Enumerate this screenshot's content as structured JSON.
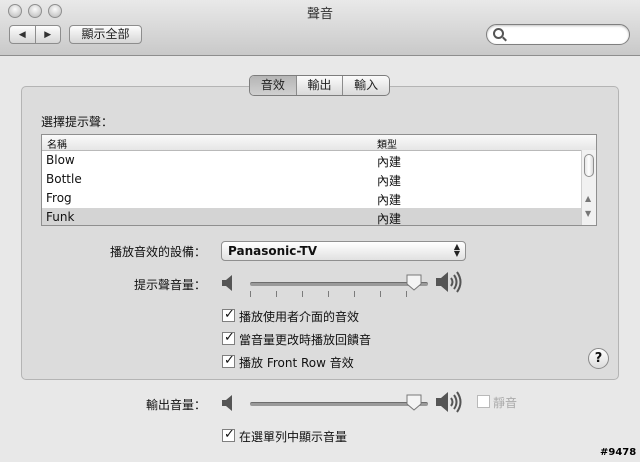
{
  "window": {
    "title": "聲音"
  },
  "toolbar": {
    "back_icon": "◀",
    "forward_icon": "▶",
    "show_all": "顯示全部",
    "search_placeholder": ""
  },
  "tabs": [
    {
      "label": "音效"
    },
    {
      "label": "輸出"
    },
    {
      "label": "輸入"
    }
  ],
  "sound_effects": {
    "choose_label": "選擇提示聲：",
    "columns": {
      "name": "名稱",
      "type": "類型"
    },
    "rows": [
      {
        "name": "Blow",
        "type": "內建"
      },
      {
        "name": "Bottle",
        "type": "內建"
      },
      {
        "name": "Frog",
        "type": "內建"
      },
      {
        "name": "Funk",
        "type": "內建"
      }
    ],
    "selected": "Funk",
    "device_label": "播放音效的設備：",
    "device_value": "Panasonic-TV",
    "alert_volume_label": "提示聲音量：",
    "alert_volume_level": 0.92,
    "options": [
      {
        "label": "播放使用者介面的音效",
        "checked": true
      },
      {
        "label": "當音量更改時播放回饋音",
        "checked": true
      },
      {
        "label": "播放 Front Row 音效",
        "checked": true
      }
    ]
  },
  "output": {
    "volume_label": "輸出音量：",
    "volume_level": 0.92,
    "mute_label": "靜音",
    "mute_checked": false,
    "show_in_menubar_label": "在選單列中顯示音量",
    "show_in_menubar_checked": true
  },
  "help_icon": "?",
  "stamp": "#9478",
  "colors": {
    "panel_bg": "#dcdcdc",
    "selected_row": "#d4d4d4"
  }
}
